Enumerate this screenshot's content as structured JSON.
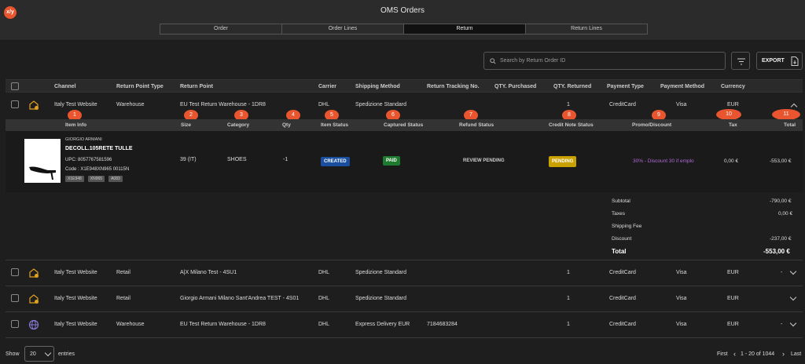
{
  "app": {
    "title": "OMS Orders",
    "logo": "x/y"
  },
  "tabs": [
    "Order",
    "Order Lines",
    "Return",
    "Return Lines"
  ],
  "search": {
    "placeholder": "Search by Return Order ID"
  },
  "export_label": "EXPORT",
  "columns": [
    "Channel",
    "Return Point Type",
    "Return Point",
    "Carrier",
    "Shipping Method",
    "Return Tracking No.",
    "QTY. Purchased",
    "QTY. Returned",
    "Payment Type",
    "Payment Method",
    "Currency"
  ],
  "rows": [
    {
      "channel": "Italy Test Website",
      "type": "Warehouse",
      "point": "EU Test Return Warehouse - 1DR8",
      "carrier": "DHL",
      "shipping": "Spedizione Standard",
      "tracking": "",
      "qty_purchased": "",
      "qty_returned": "1",
      "payment_type": "CreditCard",
      "payment_method": "Visa",
      "currency": "EUR",
      "icon": "store-return-icon"
    },
    {
      "channel": "Italy Test Website",
      "type": "Retail",
      "point": "A|X Milano Test - 4SU1",
      "carrier": "DHL",
      "shipping": "Spedizione Standard",
      "tracking": "",
      "qty_purchased": "",
      "qty_returned": "1",
      "payment_type": "CreditCard",
      "payment_method": "Visa",
      "currency": "EUR",
      "dash": "-",
      "icon": "store-return-icon"
    },
    {
      "channel": "Italy Test Website",
      "type": "Retail",
      "point": "Giorgio Armani Milano Sant'Andrea TEST - 4S01",
      "carrier": "DHL",
      "shipping": "Spedizione Standard",
      "tracking": "",
      "qty_purchased": "",
      "qty_returned": "1",
      "payment_type": "CreditCard",
      "payment_method": "Visa",
      "currency": "EUR",
      "icon": "store-return-icon"
    },
    {
      "channel": "Italy Test Website",
      "type": "Warehouse",
      "point": "EU Test Return Warehouse - 1DR8",
      "carrier": "DHL",
      "shipping": "Express Delivery EUR",
      "tracking": "7184683284",
      "qty_purchased": "",
      "qty_returned": "1",
      "payment_type": "CreditCard",
      "payment_method": "Visa",
      "currency": "EUR",
      "dash": "-",
      "icon": "globe-icon"
    }
  ],
  "sub_columns": [
    "Item Info",
    "Size",
    "Category",
    "Qty",
    "Item Status",
    "Captured Status",
    "Refund Status",
    "Credit Note Status",
    "Promo/Discount",
    "Tax",
    "Total"
  ],
  "markers": [
    "1",
    "2",
    "3",
    "4",
    "5",
    "6",
    "7",
    "8",
    "9",
    "10",
    "11"
  ],
  "item": {
    "brand": "GIORGIO ARMANI",
    "name": "DECOLL.105RETE TULLE",
    "upc": "UPC: 8057767581596",
    "code": "Code : X1E948XN965 00115N",
    "chips": [
      "X1E948",
      "XN965",
      "A083"
    ],
    "size": "39 (IT)",
    "category": "SHOES",
    "qty": "-1",
    "item_status": "CREATED",
    "captured_status": "PAID",
    "refund_status": "REVIEW PENDING",
    "credit_note_status": "PENDING",
    "promo": "30% - Discount 30 if emplo",
    "tax": "0,00 €",
    "total": "-553,00 €"
  },
  "summary": [
    {
      "label": "Subtotal",
      "value": "-790,00 €"
    },
    {
      "label": "Taxes",
      "value": "0,00 €"
    },
    {
      "label": "Shipping Fee",
      "value": ""
    },
    {
      "label": "Discount",
      "value": "-237,00 €"
    },
    {
      "label": "Total",
      "value": "-553,00 €"
    }
  ],
  "footer": {
    "show": "Show",
    "page_size": "20",
    "entries": "entries",
    "first": "First",
    "range": "1 - 20 of 1044",
    "last": "Last"
  },
  "colors": {
    "accent": "#e8552e",
    "created": "#1a4fa0",
    "paid": "#1e7a2e",
    "pending": "#c9a200",
    "promo": "#b06ad8"
  }
}
